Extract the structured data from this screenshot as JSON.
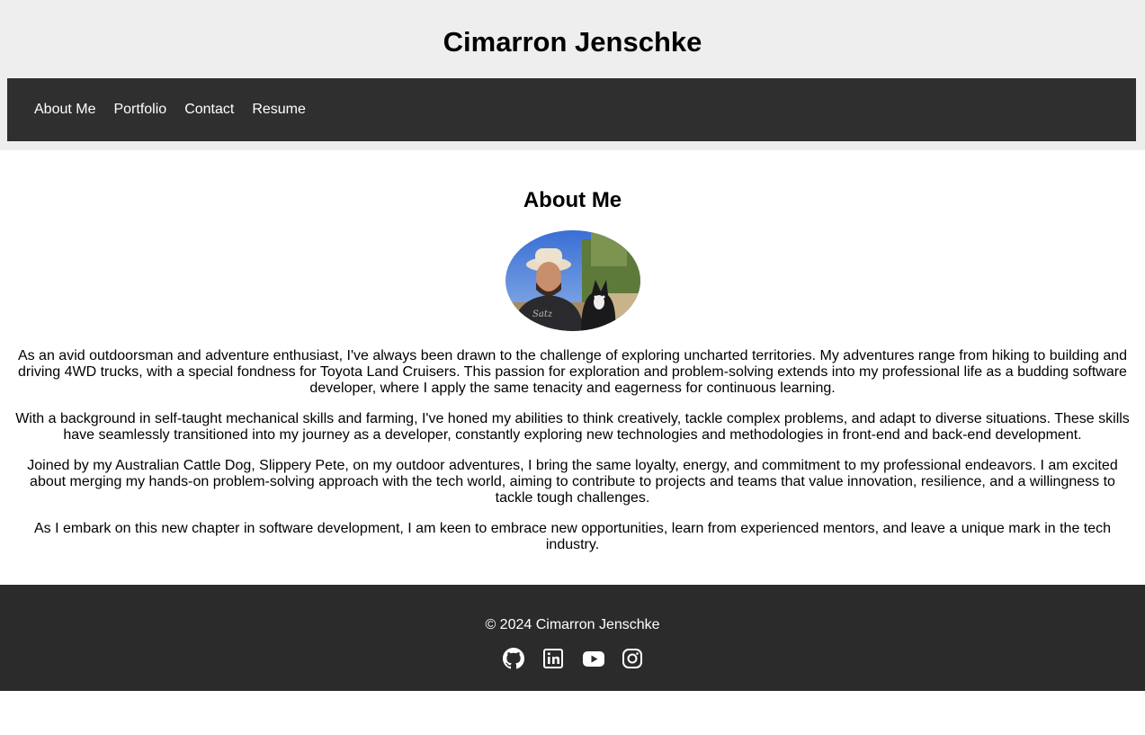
{
  "header": {
    "title": "Cimarron Jenschke"
  },
  "nav": {
    "items": [
      {
        "label": "About Me"
      },
      {
        "label": "Portfolio"
      },
      {
        "label": "Contact"
      },
      {
        "label": "Resume"
      }
    ]
  },
  "about": {
    "heading": "About Me",
    "avatar_icon": "profile-photo",
    "paragraphs": [
      "As an avid outdoorsman and adventure enthusiast, I've always been drawn to the challenge of exploring uncharted territories. My adventures range from hiking to building and driving 4WD trucks, with a special fondness for Toyota Land Cruisers. This passion for exploration and problem-solving extends into my professional life as a budding software developer, where I apply the same tenacity and eagerness for continuous learning.",
      "With a background in self-taught mechanical skills and farming, I've honed my abilities to think creatively, tackle complex problems, and adapt to diverse situations. These skills have seamlessly transitioned into my journey as a developer, constantly exploring new technologies and methodologies in front-end and back-end development.",
      "Joined by my Australian Cattle Dog, Slippery Pete, on my outdoor adventures, I bring the same loyalty, energy, and commitment to my professional endeavors. I am excited about merging my hands-on problem-solving approach with the tech world, aiming to contribute to projects and teams that value innovation, resilience, and a willingness to tackle tough challenges.",
      "As I embark on this new chapter in software development, I am keen to embrace new opportunities, learn from experienced mentors, and leave a unique mark in the tech industry."
    ]
  },
  "footer": {
    "copyright": "© 2024 Cimarron Jenschke",
    "social": [
      {
        "icon": "github-icon"
      },
      {
        "icon": "linkedin-icon"
      },
      {
        "icon": "youtube-icon"
      },
      {
        "icon": "instagram-icon"
      }
    ]
  },
  "colors": {
    "header_bg": "#eeeeee",
    "nav_bg": "#2f2f2f",
    "footer_bg": "#2b2b2b",
    "text": "#000000",
    "inverse_text": "#ffffff"
  }
}
